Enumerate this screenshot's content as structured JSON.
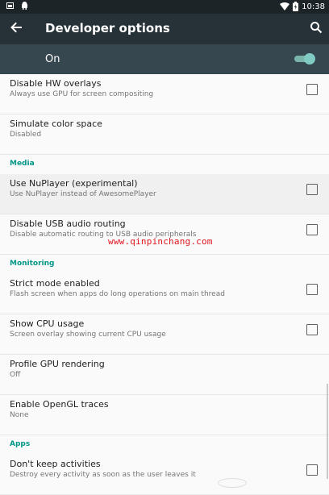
{
  "status_bar": {
    "time": "10:38",
    "icons": [
      "image-icon",
      "android-icon",
      "wifi-icon",
      "battery-icon"
    ]
  },
  "app_bar": {
    "title": "Developer options",
    "back_icon": "arrow-left-icon",
    "search_icon": "search-icon"
  },
  "master_switch": {
    "label": "On",
    "checked": true
  },
  "sections": [
    {
      "type": "item",
      "title": "Disable HW overlays",
      "summary": "Always use GPU for screen compositing",
      "checkbox": true,
      "checked": false
    },
    {
      "type": "item",
      "title": "Simulate color space",
      "summary": "Disabled",
      "checkbox": false
    },
    {
      "type": "category",
      "title": "Media"
    },
    {
      "type": "item",
      "title": "Use NuPlayer (experimental)",
      "summary": "Use NuPlayer instead of AwesomePlayer",
      "checkbox": true,
      "checked": false,
      "pressed": true
    },
    {
      "type": "item",
      "title": "Disable USB audio routing",
      "summary": "Disable automatic routing to USB audio peripherals",
      "checkbox": true,
      "checked": false
    },
    {
      "type": "category",
      "title": "Monitoring"
    },
    {
      "type": "item",
      "title": "Strict mode enabled",
      "summary": "Flash screen when apps do long operations on main thread",
      "checkbox": true,
      "checked": false
    },
    {
      "type": "item",
      "title": "Show CPU usage",
      "summary": "Screen overlay showing current CPU usage",
      "checkbox": true,
      "checked": false
    },
    {
      "type": "item",
      "title": "Profile GPU rendering",
      "summary": "Off",
      "checkbox": false
    },
    {
      "type": "item",
      "title": "Enable OpenGL traces",
      "summary": "None",
      "checkbox": false
    },
    {
      "type": "category",
      "title": "Apps"
    },
    {
      "type": "item",
      "title": "Don't keep activities",
      "summary": "Destroy every activity as soon as the user leaves it",
      "checkbox": true,
      "checked": false
    }
  ],
  "watermark": "www.qinpinchang.com",
  "colors": {
    "status_bar": "#1c2427",
    "toolbar": "#263238",
    "master_bar": "#37474f",
    "accent": "#009688",
    "switch": "#80cbc4"
  }
}
